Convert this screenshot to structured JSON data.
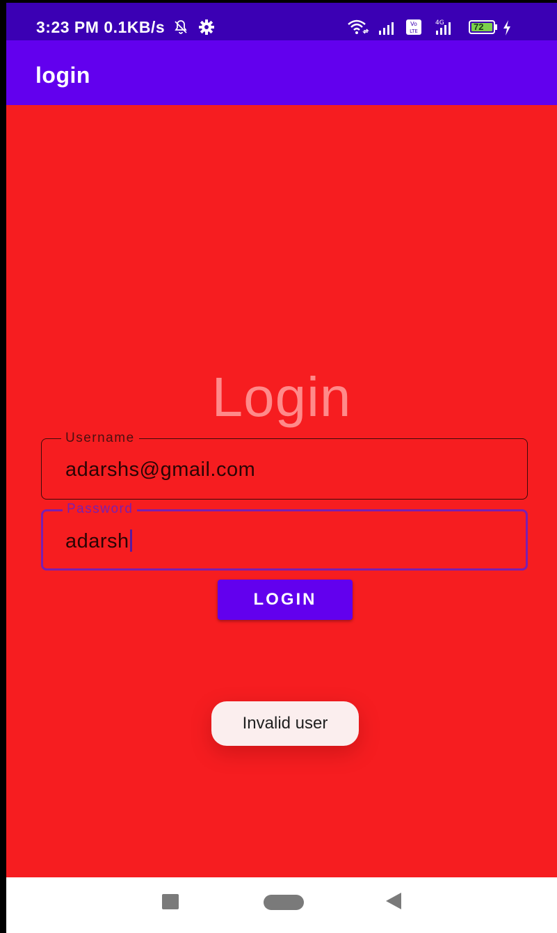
{
  "status_bar": {
    "time_and_rate": "3:23 PM  0.1KB/s",
    "battery_level": "72",
    "icons": [
      "notification-off-icon",
      "settings-gear-icon",
      "wifi-icon",
      "signal-icon",
      "volte-icon",
      "4g-signal-icon",
      "battery-icon",
      "charging-icon"
    ]
  },
  "app_bar": {
    "title": "login",
    "color": "#6200ee"
  },
  "main": {
    "heading": "Login",
    "background_color": "#f61d20",
    "username": {
      "label": "Username",
      "value": "adarshs@gmail.com"
    },
    "password": {
      "label": "Password",
      "value": "adarsh",
      "focused": true
    },
    "login_button": {
      "label": "LOGIN"
    }
  },
  "toast": {
    "message": "Invalid user"
  },
  "nav_bar": {
    "buttons": [
      "recents-icon",
      "home-icon",
      "back-icon"
    ]
  }
}
